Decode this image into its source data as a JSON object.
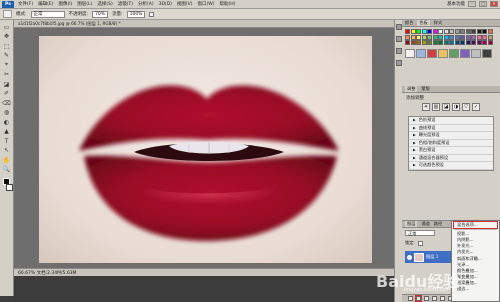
{
  "app": {
    "logo": "Ps",
    "menu": [
      "文件(F)",
      "编辑(E)",
      "图像(I)",
      "图层(L)",
      "选择(S)",
      "滤镜(T)",
      "分析(A)",
      "3D(D)",
      "视图(V)",
      "窗口(W)",
      "帮助(H)"
    ],
    "workspace_label": "基本功能",
    "window_buttons": [
      "-",
      "□",
      "×"
    ]
  },
  "options_bar": {
    "mode_label": "模式:",
    "mode_value": "正常",
    "opacity_label": "不透明度:",
    "opacity_value": "70%",
    "flow_label": "流量:",
    "flow_value": "100%"
  },
  "document": {
    "tab_title": "a1d1f2a0c7f8b1f5.jpg @ 66.7% (图层 1, RGB/8) *",
    "status_text": "66.67%   文档:2.34M/5.63M"
  },
  "tools": [
    "▭",
    "✥",
    "⬚",
    "✎",
    "⌖",
    "✂",
    "◪",
    "✐",
    "⌫",
    "◍",
    "◐",
    "▲",
    "T",
    "↖",
    "✋",
    "🔍"
  ],
  "right_panel": {
    "swatch_tab": "颜色",
    "swatch_tab2": "色板",
    "swatch_tab3": "样式",
    "adjust_tab": "调整",
    "adjust_tab2": "蒙版",
    "adjust_title": "添加调整",
    "adjust_icons": [
      "☀",
      "▥",
      "◪",
      "◑",
      "▽",
      "✓"
    ],
    "presets": [
      "色阶预设",
      "曲线预设",
      "曝光度预设",
      "色相/饱和度预设",
      "黑白预设",
      "通道混合器预设",
      "可选颜色预设"
    ]
  },
  "layers": {
    "tab": "图层",
    "tab2": "通道",
    "tab3": "路径",
    "blend_mode": "正常",
    "lock_label": "锁定:",
    "layer_name": "图层 1"
  },
  "context_menu": {
    "items": [
      "混合选项...",
      "投影...",
      "内阴影...",
      "外发光...",
      "内发光...",
      "斜面和浮雕...",
      "光泽...",
      "颜色叠加...",
      "渐变叠加...",
      "图案叠加...",
      "描边..."
    ]
  },
  "watermark": {
    "brand": "Baidu经验",
    "url": "jingyan.baidu.com"
  },
  "colors": {
    "lip_red": "#a0102a",
    "lip_dark": "#5e0414",
    "skin": "#ecdfd7",
    "highlight_red": "#d42a2a",
    "ui_gray": "#d4d0c8"
  }
}
